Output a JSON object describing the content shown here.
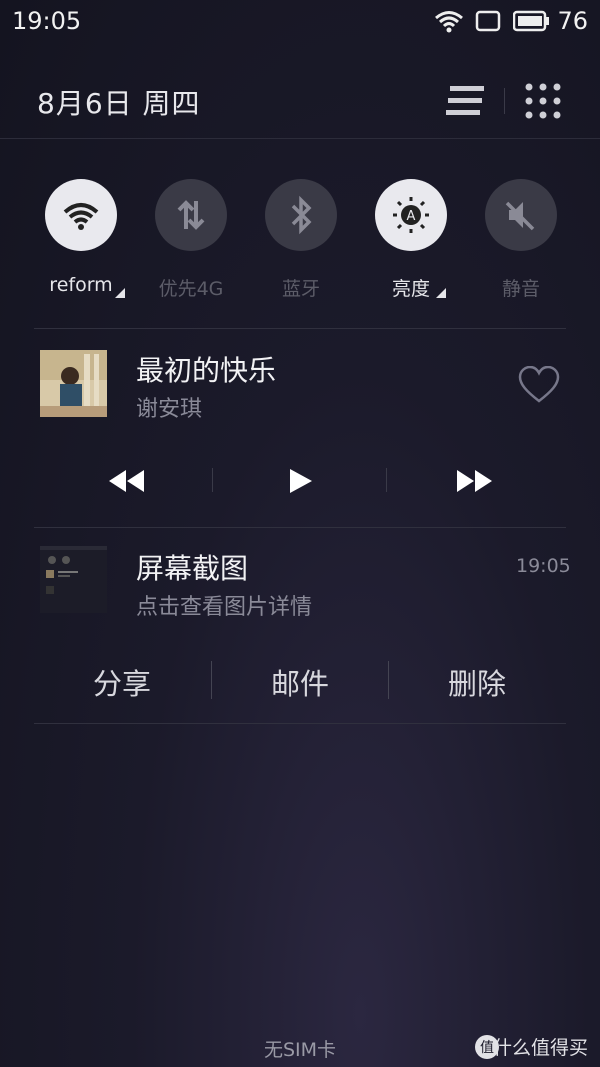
{
  "status_bar": {
    "time": "19:05",
    "battery_percent": "76"
  },
  "header": {
    "date": "8月6日  周四"
  },
  "toggles": [
    {
      "label": "reform",
      "icon": "wifi-icon",
      "state": "on"
    },
    {
      "label": "优先4G",
      "icon": "data-arrows-icon",
      "state": "off"
    },
    {
      "label": "蓝牙",
      "icon": "bluetooth-icon",
      "state": "off"
    },
    {
      "label": "亮度",
      "icon": "auto-brightness-icon",
      "state": "on"
    },
    {
      "label": "静音",
      "icon": "mute-icon",
      "state": "off"
    }
  ],
  "music": {
    "title": "最初的快乐",
    "artist": "谢安琪"
  },
  "notification": {
    "title": "屏幕截图",
    "subtitle": "点击查看图片详情",
    "time": "19:05"
  },
  "actions": {
    "share": "分享",
    "mail": "邮件",
    "delete": "删除"
  },
  "footer": {
    "no_sim": "无SIM卡",
    "watermark": "什么值得买"
  },
  "colors": {
    "toggle_on": "#e9e9ee",
    "toggle_off": "#3a3a46",
    "accent_text": "#f2f2f4"
  }
}
